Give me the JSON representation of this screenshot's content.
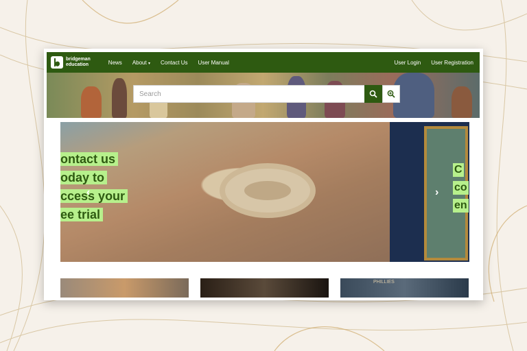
{
  "brand": {
    "line1": "bridgeman",
    "line2": "education"
  },
  "nav": {
    "items": [
      "News",
      "About",
      "Contact Us",
      "User Manual"
    ],
    "about_caret": "▾",
    "right": [
      "User Login",
      "User Registration"
    ]
  },
  "search": {
    "placeholder": "Search"
  },
  "carousel": {
    "promo_lines": [
      "ontact us",
      "oday to",
      "ccess your",
      "ee trial"
    ],
    "side_lines": [
      "C",
      "co",
      "en"
    ],
    "prev_arrow": "‹",
    "next_arrow": "›"
  },
  "thumbnails": {
    "caption_3": "PHILLIES"
  },
  "colors": {
    "brand_green": "#2e5a11",
    "promo_green": "#b7f08c"
  }
}
